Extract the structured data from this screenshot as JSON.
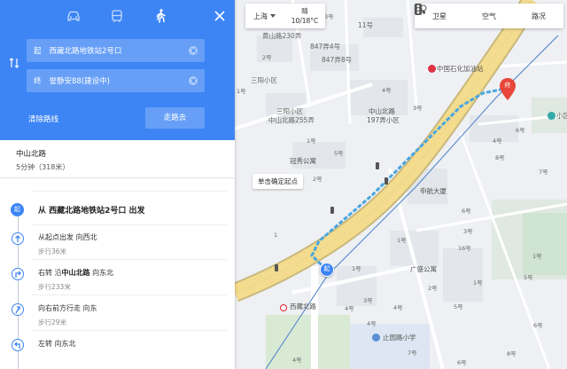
{
  "header": {
    "modes": [
      {
        "name": "driving",
        "icon": "car-icon"
      },
      {
        "name": "transit",
        "icon": "bus-icon"
      },
      {
        "name": "walking",
        "icon": "walk-icon",
        "active": true
      }
    ],
    "close_icon": "close-icon"
  },
  "route": {
    "start_tag": "起",
    "start_value": "西藏北路地铁站2号口",
    "end_tag": "终",
    "end_value": "誉静安88(建设中)",
    "clear_label": "清除路线",
    "go_label": "走路去"
  },
  "summary": {
    "road": "中山北路",
    "duration": "5分钟（318米）"
  },
  "steps": {
    "start_badge": "起",
    "start_title": "从 西藏北路地铁站2号口 出发",
    "items": [
      {
        "pre": "从起点出发 向西北",
        "bold": "",
        "post": "",
        "sub": "步行36米"
      },
      {
        "pre": "右转 沿",
        "bold": "中山北路",
        "post": " 向东北",
        "sub": "步行233米"
      },
      {
        "pre": "向右前方行走 向东",
        "bold": "",
        "post": "",
        "sub": "步行29米"
      },
      {
        "pre": "左转 向东北",
        "bold": "",
        "post": "",
        "sub": ""
      }
    ]
  },
  "map": {
    "city": "上海",
    "weather_cond": "晴",
    "weather_temp": "10/18°C",
    "layers": [
      {
        "label": "卫星",
        "icon": "satellite-icon"
      },
      {
        "label": "空气",
        "icon": "air-icon"
      },
      {
        "label": "路况",
        "icon": "traffic-light-icon"
      }
    ],
    "tooltip": "单击确定起点",
    "start_marker": "起",
    "end_marker": "终",
    "labels": {
      "l1": "黄山路230弄",
      "l2": "847弄4号",
      "l3": "847弄8号",
      "l4": "11号",
      "l5": "三阳小区",
      "l6": "三阳小区",
      "l7": "中山北路255弄",
      "l8": "中山北路",
      "l9": "197弄小区",
      "l10": "中国石化加油站",
      "l11": "冠秀公寓",
      "l12": "申航大厦",
      "l13": "广盛公寓",
      "l14": "西藏北路",
      "l15": "止园路小学",
      "l16": "小区",
      "l17": "3号",
      "l18": "2号",
      "l19": "1号",
      "l20": "1号",
      "l21": "4号",
      "l22": "3号",
      "l23": "5号",
      "l24": "2号",
      "l25": "16号",
      "l26": "6号",
      "l27": "8号",
      "l28": "7号",
      "l29": "1号",
      "l30": "4号",
      "l31": "6号",
      "l32": "1号",
      "l33": "3号",
      "l34": "2号",
      "l35": "4号",
      "l36": "5号",
      "l37": "5号",
      "l38": "1号",
      "l39": "6号",
      "l40": "1",
      "l41": "1号",
      "l42": "4号",
      "l43": "4号",
      "l44": "6号",
      "l45": "4号",
      "l46": "8号",
      "l47": "3号",
      "l48": "7号"
    }
  }
}
